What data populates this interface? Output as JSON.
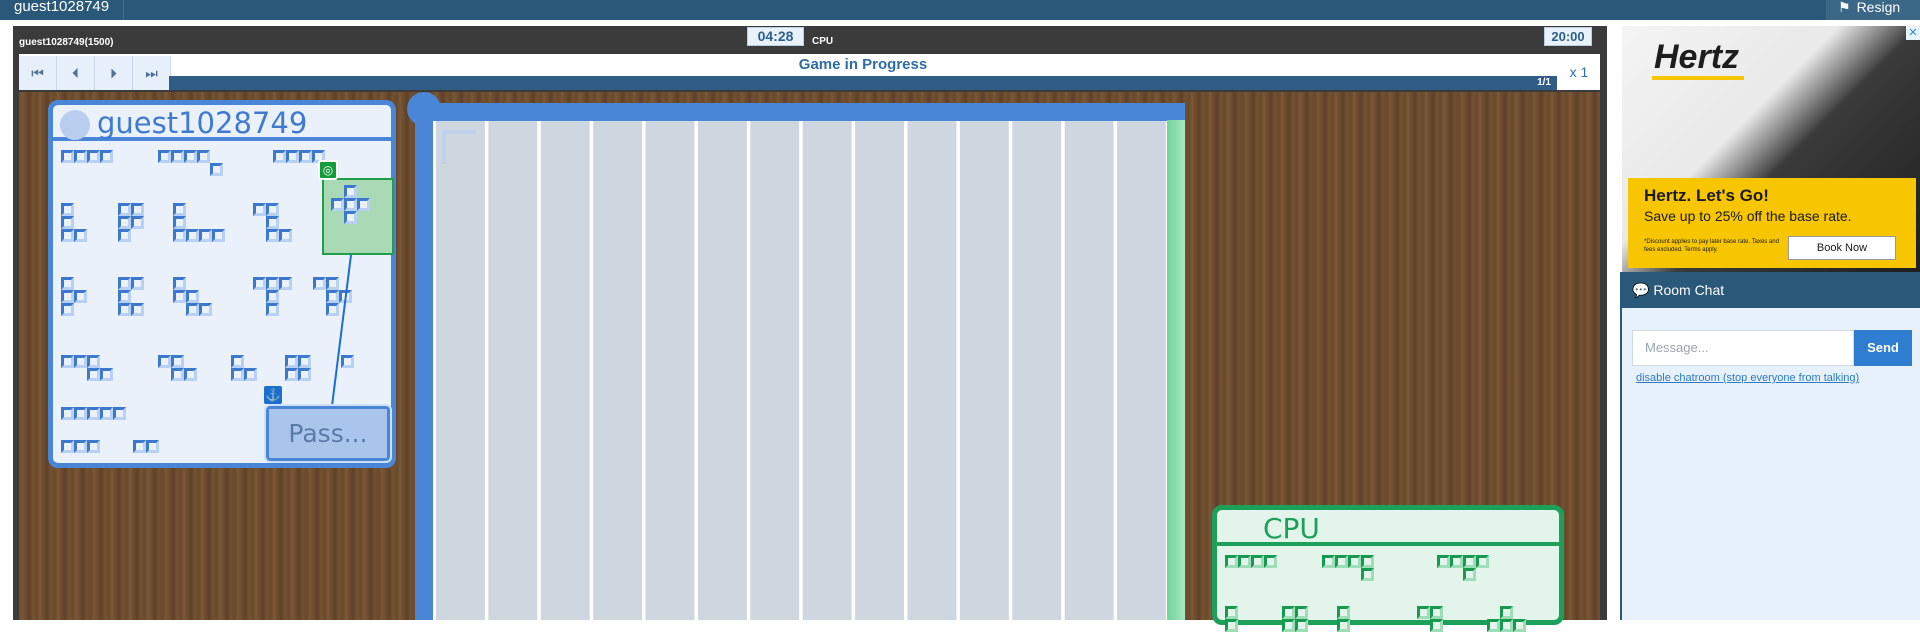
{
  "topbar": {
    "username": "guest1028749",
    "resign_label": "Resign",
    "resign_icon": "flag-icon"
  },
  "game": {
    "player1_header": "guest1028749(1500)",
    "player2_header": "CPU",
    "clock1": "04:28",
    "clock2": "20:00",
    "status": "Game in Progress",
    "move_count": "1/1",
    "speed": "x 1",
    "nav_icons": [
      "first-move-icon",
      "prev-move-icon",
      "next-move-icon",
      "last-move-icon"
    ]
  },
  "player_panel": {
    "name": "guest1028749",
    "pass_label": "Pass...",
    "color": "#4a86d8"
  },
  "cpu_panel": {
    "name": "CPU",
    "color": "#1ca05a"
  },
  "ad": {
    "brand": "Hertz",
    "headline": "Hertz. Let's Go!",
    "offer": "Save up to 25% off the base rate.",
    "fine_print": "*Discount applies to pay later base rate. Taxes and fees excluded. Terms apply.",
    "cta": "Book Now"
  },
  "chat": {
    "title": "Room Chat",
    "placeholder": "Message...",
    "send_label": "Send",
    "disable_link": "disable chatroom (stop everyone from talking)"
  }
}
